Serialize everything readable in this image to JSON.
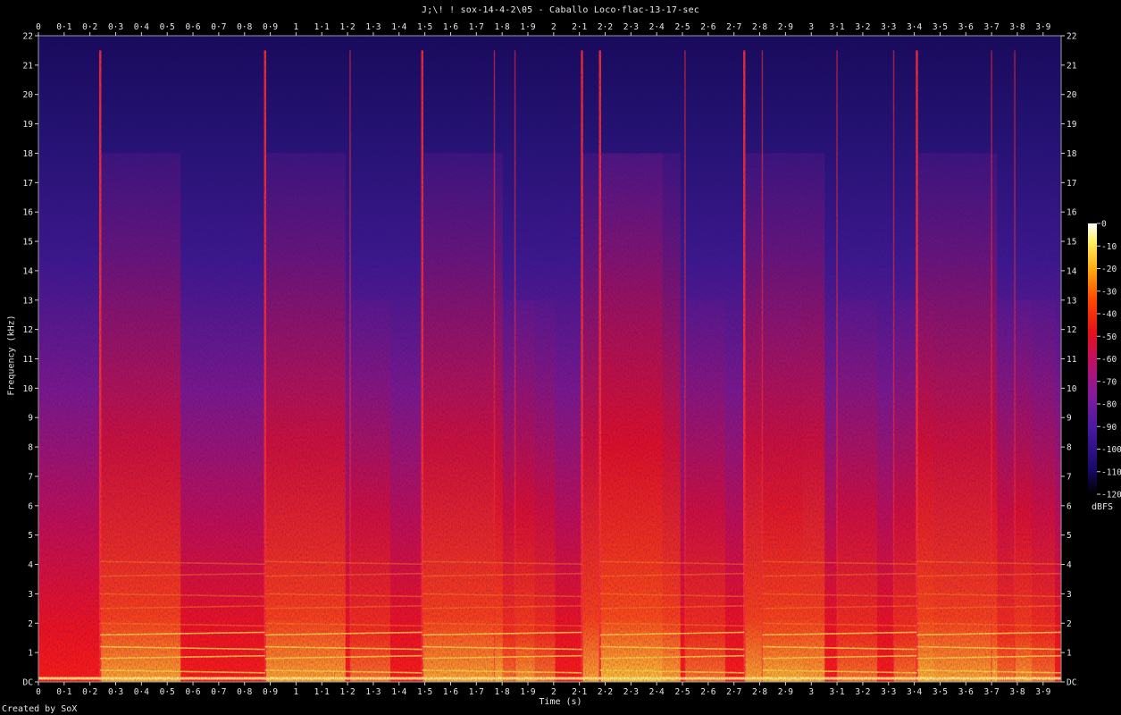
{
  "title": "J;\\! ! sox-14-4-2\\05 - Caballo Loco·flac-13-17-sec",
  "credit": "Created by SoX",
  "chart_data": {
    "type": "heatmap",
    "xlabel": "Time (s)",
    "ylabel": "Frequency (kHz)",
    "xlim": [
      0,
      3.97
    ],
    "ylim": [
      0,
      22
    ],
    "x_ticks": [
      "0",
      "0·1",
      "0·2",
      "0·3",
      "0·4",
      "0·5",
      "0·6",
      "0·7",
      "0·8",
      "0·9",
      "1",
      "1·1",
      "1·2",
      "1·3",
      "1·4",
      "1·5",
      "1·6",
      "1·7",
      "1·8",
      "1·9",
      "2",
      "2·1",
      "2·2",
      "2·3",
      "2·4",
      "2·5",
      "2·6",
      "2·7",
      "2·8",
      "2·9",
      "3",
      "3·1",
      "3·2",
      "3·3",
      "3·4",
      "3·5",
      "3·6",
      "3·7",
      "3·8",
      "3·9"
    ],
    "y_ticks": [
      "DC",
      "1",
      "2",
      "3",
      "4",
      "5",
      "6",
      "7",
      "8",
      "9",
      "10",
      "11",
      "12",
      "13",
      "14",
      "15",
      "16",
      "17",
      "18",
      "19",
      "20",
      "21",
      "22"
    ],
    "colorbar": {
      "label": "dBFS",
      "range": [
        -120,
        0
      ],
      "ticks": [
        "0",
        "-10",
        "-20",
        "-30",
        "-40",
        "-50",
        "-60",
        "-70",
        "-80",
        "-90",
        "-100",
        "-110",
        "-120"
      ],
      "colors": [
        "#000000",
        "#1a0a6e",
        "#4a1aa0",
        "#8a1a9a",
        "#c01060",
        "#e8101a",
        "#ff4a00",
        "#ffaa10",
        "#ffee60",
        "#ffffff"
      ]
    },
    "onsets_s": [
      0.24,
      0.88,
      1.21,
      1.49,
      1.77,
      1.85,
      2.11,
      2.18,
      2.51,
      2.74,
      2.81,
      3.1,
      3.32,
      3.41,
      3.7,
      3.79
    ],
    "strong_onsets_s": [
      0.24,
      0.88,
      1.49,
      2.11,
      2.18,
      2.74,
      3.41
    ]
  }
}
